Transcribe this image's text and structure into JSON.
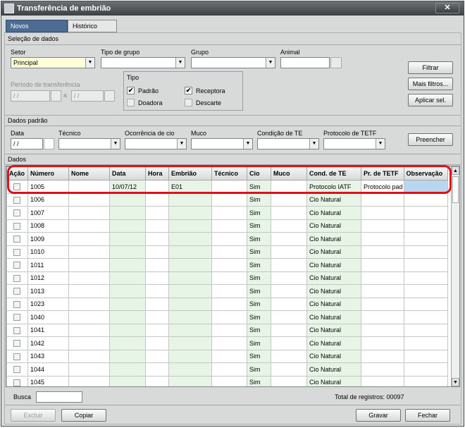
{
  "window": {
    "title": "Transferência de embrião",
    "close_label": "✕"
  },
  "tabs": [
    {
      "label": "Novos lançamentos"
    },
    {
      "label": "Histórico"
    }
  ],
  "selecao": {
    "section_label": "Seleção de dados",
    "setor_label": "Setor",
    "setor_value": "Principal",
    "tipo_grupo_label": "Tipo de grupo",
    "tipo_grupo_value": "",
    "grupo_label": "Grupo",
    "grupo_value": "",
    "animal_label": "Animal",
    "animal_value": "",
    "periodo_label": "Período de transferência",
    "periodo_from": "/ /",
    "periodo_sep": "a",
    "periodo_to": "/ /",
    "tipo_label": "Tipo",
    "tipo_options": [
      {
        "label": "Padrão",
        "checked": true,
        "mark": "✔"
      },
      {
        "label": "Receptora",
        "checked": true,
        "mark": "✔"
      },
      {
        "label": "Doadora",
        "checked": false,
        "mark": ""
      },
      {
        "label": "Descarte",
        "checked": false,
        "mark": ""
      }
    ],
    "filtrar_label": "Filtrar",
    "mais_filtros_label": "Mais filtros...",
    "aplicar_sel_label": "Aplicar sel."
  },
  "dados_padrao": {
    "section_label": "Dados padrão",
    "data_label": "Data",
    "data_value": "/ /",
    "tecnico_label": "Técnico",
    "ocorrencia_label": "Ocorrência de cio",
    "muco_label": "Muco",
    "condicao_label": "Condição de TE",
    "protocolo_label": "Protocolo de TETF",
    "preencher_label": "Preencher"
  },
  "dados": {
    "section_label": "Dados",
    "columns": [
      "Ação",
      "Número",
      "Nome",
      "Data",
      "Hora",
      "Embrião",
      "Técnico",
      "Cio",
      "Muco",
      "Cond. de TE",
      "Pr. de TETF",
      "Observação"
    ],
    "rows": [
      {
        "numero": "1005",
        "nome": "",
        "data": "10/07/12",
        "hora": "",
        "embriao": "E01",
        "tecnico": "",
        "cio": "Sim",
        "muco": "",
        "cond": "Protocolo IATF",
        "prtetf": "Protocolo pad",
        "obs": ""
      },
      {
        "numero": "1006",
        "nome": "",
        "data": "",
        "hora": "",
        "embriao": "",
        "tecnico": "",
        "cio": "Sim",
        "muco": "",
        "cond": "Cio Natural",
        "prtetf": "",
        "obs": ""
      },
      {
        "numero": "1007",
        "nome": "",
        "data": "",
        "hora": "",
        "embriao": "",
        "tecnico": "",
        "cio": "Sim",
        "muco": "",
        "cond": "Cio Natural",
        "prtetf": "",
        "obs": ""
      },
      {
        "numero": "1008",
        "nome": "",
        "data": "",
        "hora": "",
        "embriao": "",
        "tecnico": "",
        "cio": "Sim",
        "muco": "",
        "cond": "Cio Natural",
        "prtetf": "",
        "obs": ""
      },
      {
        "numero": "1009",
        "nome": "",
        "data": "",
        "hora": "",
        "embriao": "",
        "tecnico": "",
        "cio": "Sim",
        "muco": "",
        "cond": "Cio Natural",
        "prtetf": "",
        "obs": ""
      },
      {
        "numero": "1010",
        "nome": "",
        "data": "",
        "hora": "",
        "embriao": "",
        "tecnico": "",
        "cio": "Sim",
        "muco": "",
        "cond": "Cio Natural",
        "prtetf": "",
        "obs": ""
      },
      {
        "numero": "1011",
        "nome": "",
        "data": "",
        "hora": "",
        "embriao": "",
        "tecnico": "",
        "cio": "Sim",
        "muco": "",
        "cond": "Cio Natural",
        "prtetf": "",
        "obs": ""
      },
      {
        "numero": "1012",
        "nome": "",
        "data": "",
        "hora": "",
        "embriao": "",
        "tecnico": "",
        "cio": "Sim",
        "muco": "",
        "cond": "Cio Natural",
        "prtetf": "",
        "obs": ""
      },
      {
        "numero": "1013",
        "nome": "",
        "data": "",
        "hora": "",
        "embriao": "",
        "tecnico": "",
        "cio": "Sim",
        "muco": "",
        "cond": "Cio Natural",
        "prtetf": "",
        "obs": ""
      },
      {
        "numero": "1023",
        "nome": "",
        "data": "",
        "hora": "",
        "embriao": "",
        "tecnico": "",
        "cio": "Sim",
        "muco": "",
        "cond": "Cio Natural",
        "prtetf": "",
        "obs": ""
      },
      {
        "numero": "1040",
        "nome": "",
        "data": "",
        "hora": "",
        "embriao": "",
        "tecnico": "",
        "cio": "Sim",
        "muco": "",
        "cond": "Cio Natural",
        "prtetf": "",
        "obs": ""
      },
      {
        "numero": "1041",
        "nome": "",
        "data": "",
        "hora": "",
        "embriao": "",
        "tecnico": "",
        "cio": "Sim",
        "muco": "",
        "cond": "Cio Natural",
        "prtetf": "",
        "obs": ""
      },
      {
        "numero": "1042",
        "nome": "",
        "data": "",
        "hora": "",
        "embriao": "",
        "tecnico": "",
        "cio": "Sim",
        "muco": "",
        "cond": "Cio Natural",
        "prtetf": "",
        "obs": ""
      },
      {
        "numero": "1043",
        "nome": "",
        "data": "",
        "hora": "",
        "embriao": "",
        "tecnico": "",
        "cio": "Sim",
        "muco": "",
        "cond": "Cio Natural",
        "prtetf": "",
        "obs": ""
      },
      {
        "numero": "1044",
        "nome": "",
        "data": "",
        "hora": "",
        "embriao": "",
        "tecnico": "",
        "cio": "Sim",
        "muco": "",
        "cond": "Cio Natural",
        "prtetf": "",
        "obs": ""
      },
      {
        "numero": "1045",
        "nome": "",
        "data": "",
        "hora": "",
        "embriao": "",
        "tecnico": "",
        "cio": "Sim",
        "muco": "",
        "cond": "Cio Natural",
        "prtetf": "",
        "obs": ""
      }
    ]
  },
  "footer": {
    "busca_label": "Busca",
    "busca_value": "",
    "total_label": "Total de registros: 00097",
    "excluir_label": "Excluir",
    "copiar_label": "Copiar",
    "gravar_label": "Gravar",
    "fechar_label": "Fechar"
  },
  "colors": {
    "titlebar": "#4a4e50",
    "active_tab": "#4c6c93",
    "editable_cell": "#e6f5e6",
    "highlight": "#e0101a"
  }
}
